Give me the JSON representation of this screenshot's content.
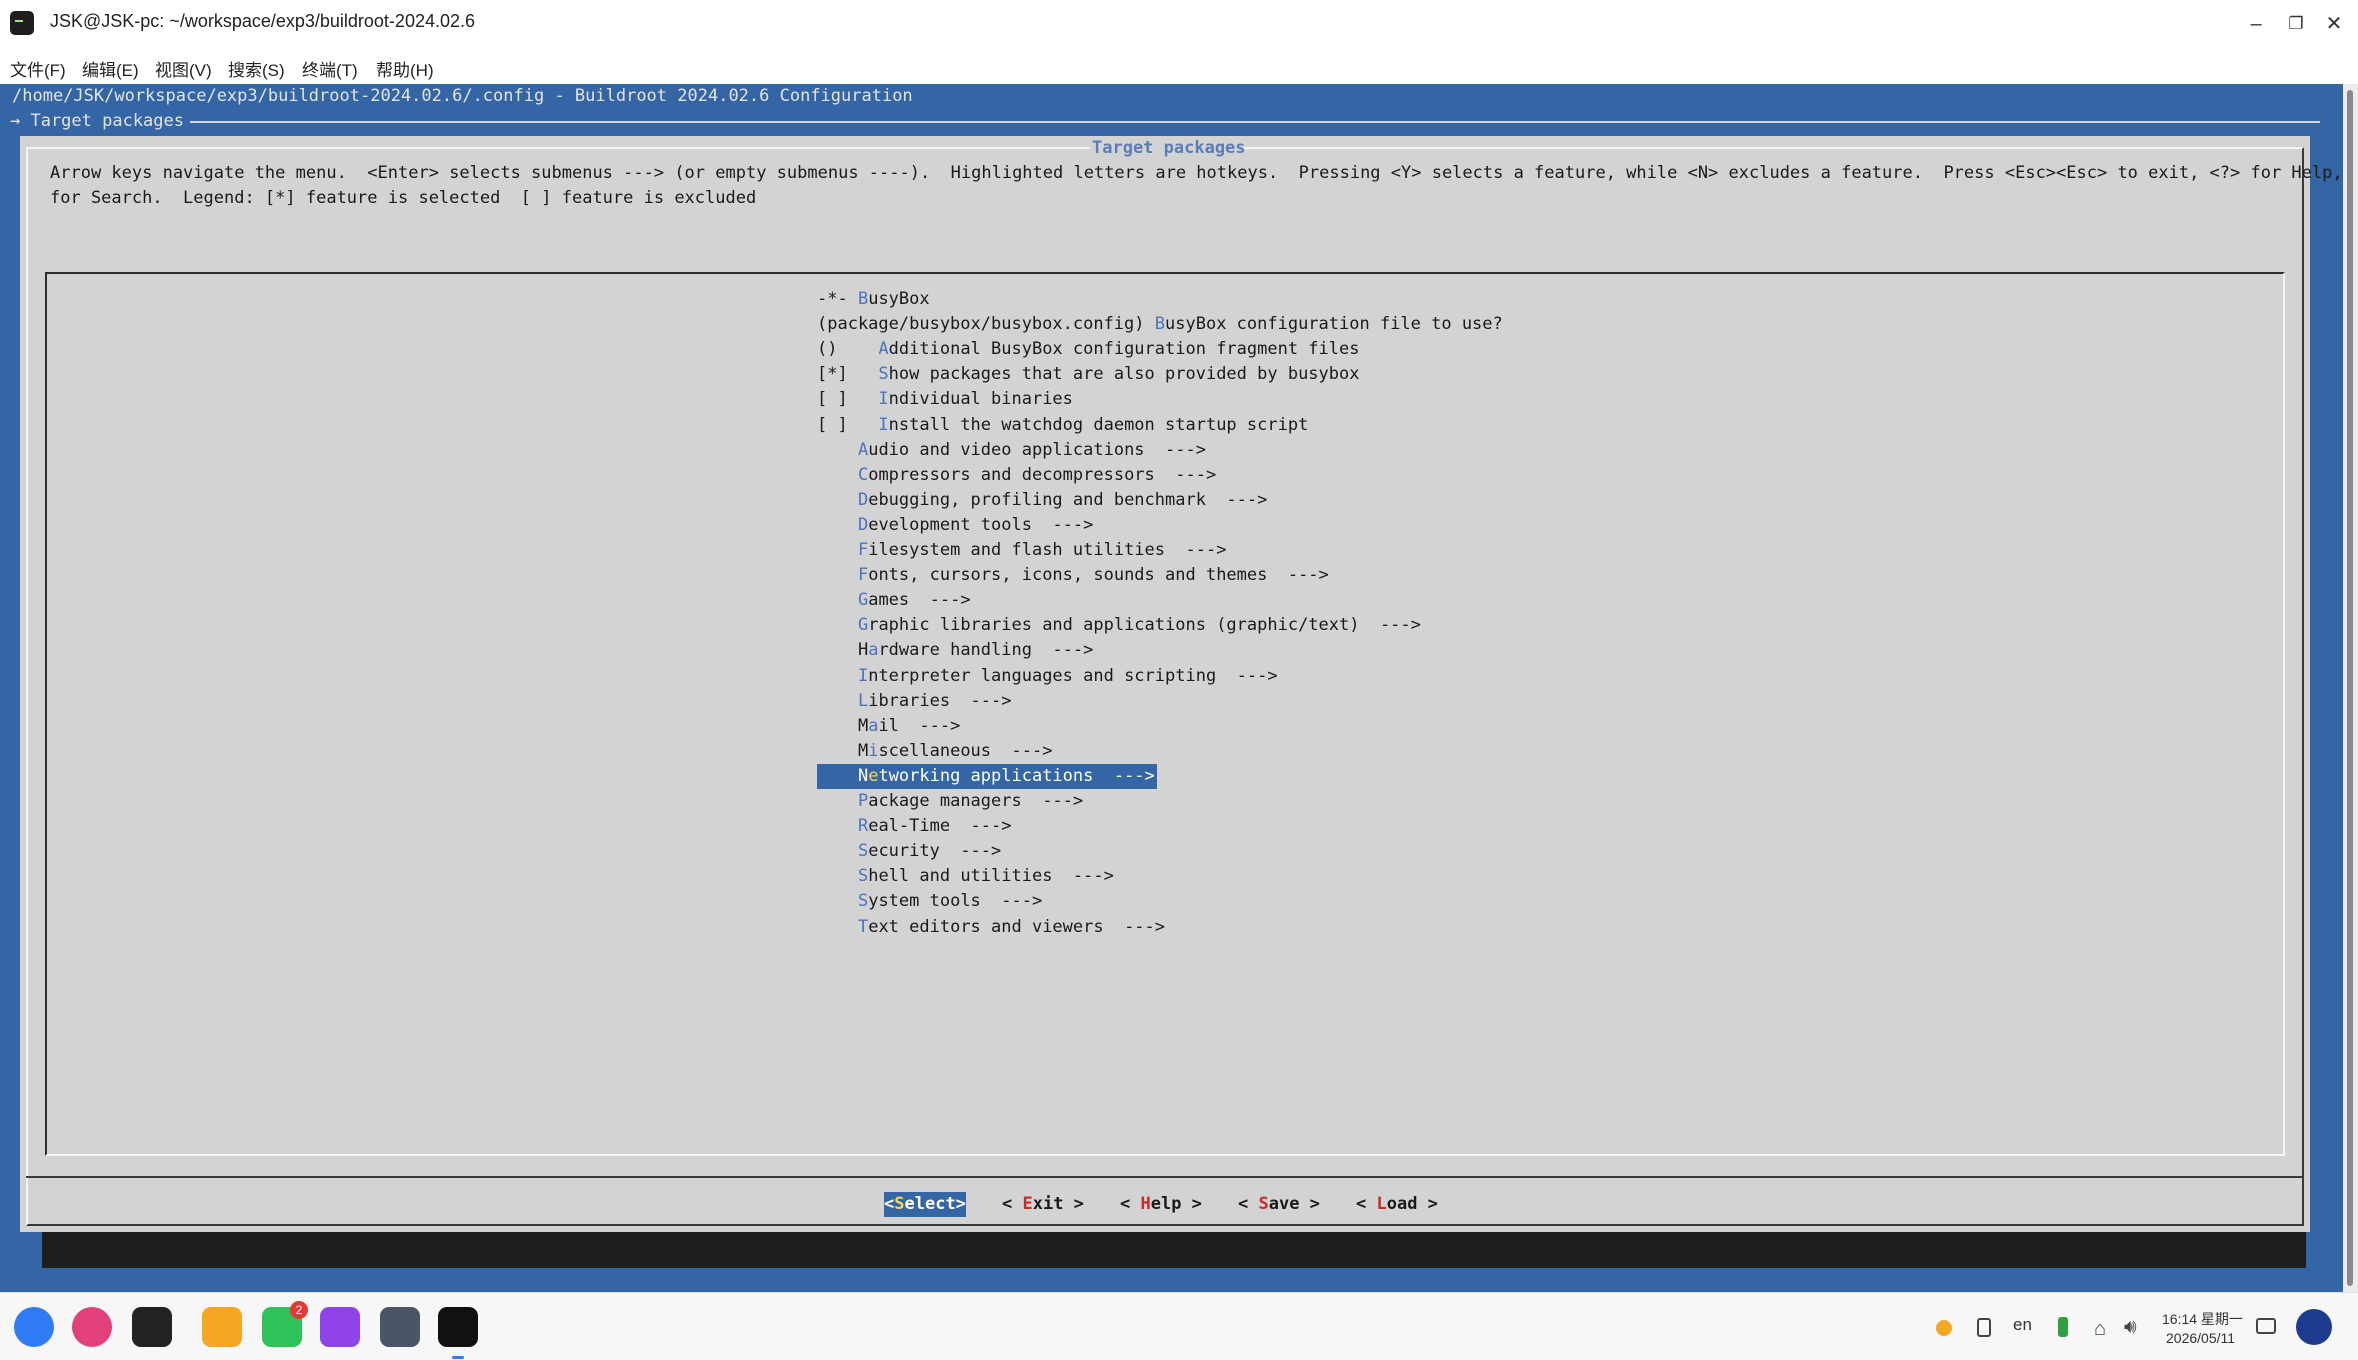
{
  "window": {
    "title": "JSK@JSK-pc: ~/workspace/exp3/buildroot-2024.02.6",
    "controls": {
      "minimize": "–",
      "restore": "❐",
      "close": "✕"
    }
  },
  "menubar": [
    {
      "label": "文件(F)"
    },
    {
      "label": "编辑(E)"
    },
    {
      "label": "视图(V)"
    },
    {
      "label": "搜索(S)"
    },
    {
      "label": "终端(T)"
    },
    {
      "label": "帮助(H)"
    }
  ],
  "terminal": {
    "config_path": "/home/JSK/workspace/exp3/buildroot-2024.02.6/.config - Buildroot 2024.02.6 Configuration",
    "breadcrumb": "→ Target packages"
  },
  "dialog": {
    "title": "Target packages",
    "help_line1": "Arrow keys navigate the menu.  <Enter> selects submenus ---> (or empty submenus ----).  Highlighted letters are hotkeys.  Pressing <Y> selects a feature, while <N> excludes a feature.  Press <Esc><Esc> to exit, <?> for Help, </>",
    "help_line2": "for Search.  Legend: [*] feature is selected  [ ] feature is excluded",
    "items": [
      {
        "pre": "-*- ",
        "hk": "B",
        "rest": "usyBox",
        "selected": false
      },
      {
        "pre": "(package/busybox/busybox.config) ",
        "hk": "B",
        "rest": "usyBox configuration file to use?",
        "selected": false
      },
      {
        "pre": "()    ",
        "hk": "A",
        "rest": "dditional BusyBox configuration fragment files",
        "selected": false
      },
      {
        "pre": "[*]   ",
        "hk": "S",
        "rest": "how packages that are also provided by busybox",
        "selected": false
      },
      {
        "pre": "[ ]   ",
        "hk": "I",
        "rest": "ndividual binaries",
        "selected": false
      },
      {
        "pre": "[ ]   ",
        "hk": "I",
        "rest": "nstall the watchdog daemon startup script",
        "selected": false
      },
      {
        "pre": "    ",
        "hk": "A",
        "rest": "udio and video applications  --->",
        "selected": false
      },
      {
        "pre": "    ",
        "hk": "C",
        "rest": "ompressors and decompressors  --->",
        "selected": false
      },
      {
        "pre": "    ",
        "hk": "D",
        "rest": "ebugging, profiling and benchmark  --->",
        "selected": false
      },
      {
        "pre": "    ",
        "hk": "D",
        "rest": "evelopment tools  --->",
        "selected": false
      },
      {
        "pre": "    ",
        "hk": "F",
        "rest": "ilesystem and flash utilities  --->",
        "selected": false
      },
      {
        "pre": "    ",
        "hk": "F",
        "rest": "onts, cursors, icons, sounds and themes  --->",
        "selected": false
      },
      {
        "pre": "    ",
        "hk": "G",
        "rest": "ames  --->",
        "selected": false
      },
      {
        "pre": "    ",
        "hk": "G",
        "rest": "raphic libraries and applications (graphic/text)  --->",
        "selected": false
      },
      {
        "pre": "    H",
        "hk": "a",
        "rest": "rdware handling  --->",
        "selected": false
      },
      {
        "pre": "    ",
        "hk": "I",
        "rest": "nterpreter languages and scripting  --->",
        "selected": false
      },
      {
        "pre": "    ",
        "hk": "L",
        "rest": "ibraries  --->",
        "selected": false
      },
      {
        "pre": "    M",
        "hk": "a",
        "rest": "il  --->",
        "selected": false
      },
      {
        "pre": "    M",
        "hk": "i",
        "rest": "scellaneous  --->",
        "selected": false
      },
      {
        "pre": "    N",
        "hk": "e",
        "rest": "tworking applications  --->",
        "selected": true
      },
      {
        "pre": "    ",
        "hk": "P",
        "rest": "ackage managers  --->",
        "selected": false
      },
      {
        "pre": "    ",
        "hk": "R",
        "rest": "eal-Time  --->",
        "selected": false
      },
      {
        "pre": "    ",
        "hk": "S",
        "rest": "ecurity  --->",
        "selected": false
      },
      {
        "pre": "    ",
        "hk": "S",
        "rest": "hell and utilities  --->",
        "selected": false
      },
      {
        "pre": "    ",
        "hk": "S",
        "rest": "ystem tools  --->",
        "selected": false
      },
      {
        "pre": "    ",
        "hk": "T",
        "rest": "ext editors and viewers  --->",
        "selected": false
      }
    ],
    "buttons": [
      {
        "pre": "<",
        "hk": "S",
        "rest": "elect>",
        "selected": true
      },
      {
        "pre": "< ",
        "hk": "E",
        "rest": "xit >",
        "selected": false
      },
      {
        "pre": "< ",
        "hk": "H",
        "rest": "elp >",
        "selected": false
      },
      {
        "pre": "< ",
        "hk": "S",
        "rest": "ave >",
        "selected": false
      },
      {
        "pre": "< ",
        "hk": "L",
        "rest": "oad >",
        "selected": false
      }
    ]
  },
  "taskbar": {
    "apps": [
      {
        "name": "launcher",
        "icon": "launcher-icon",
        "color": "#2f7cf6"
      },
      {
        "name": "search",
        "icon": "search-icon",
        "color": "#e2407a"
      },
      {
        "name": "multitask",
        "icon": "multitask-view-icon",
        "color": "#222222"
      },
      {
        "name": "file manager",
        "icon": "folder-icon",
        "color": "#f5a623"
      },
      {
        "name": "messages",
        "icon": "chat-icon",
        "color": "#2ec25a",
        "badge": "2"
      },
      {
        "name": "camera",
        "icon": "camera-icon",
        "color": "#8e44e8"
      },
      {
        "name": "settings",
        "icon": "gear-icon",
        "color": "#4a5568"
      },
      {
        "name": "terminal",
        "icon": "terminal-icon",
        "color": "#111111",
        "active": true
      }
    ],
    "tray": {
      "lang": "en",
      "time": "16:14 星期一",
      "date": "2026/05/11"
    }
  }
}
